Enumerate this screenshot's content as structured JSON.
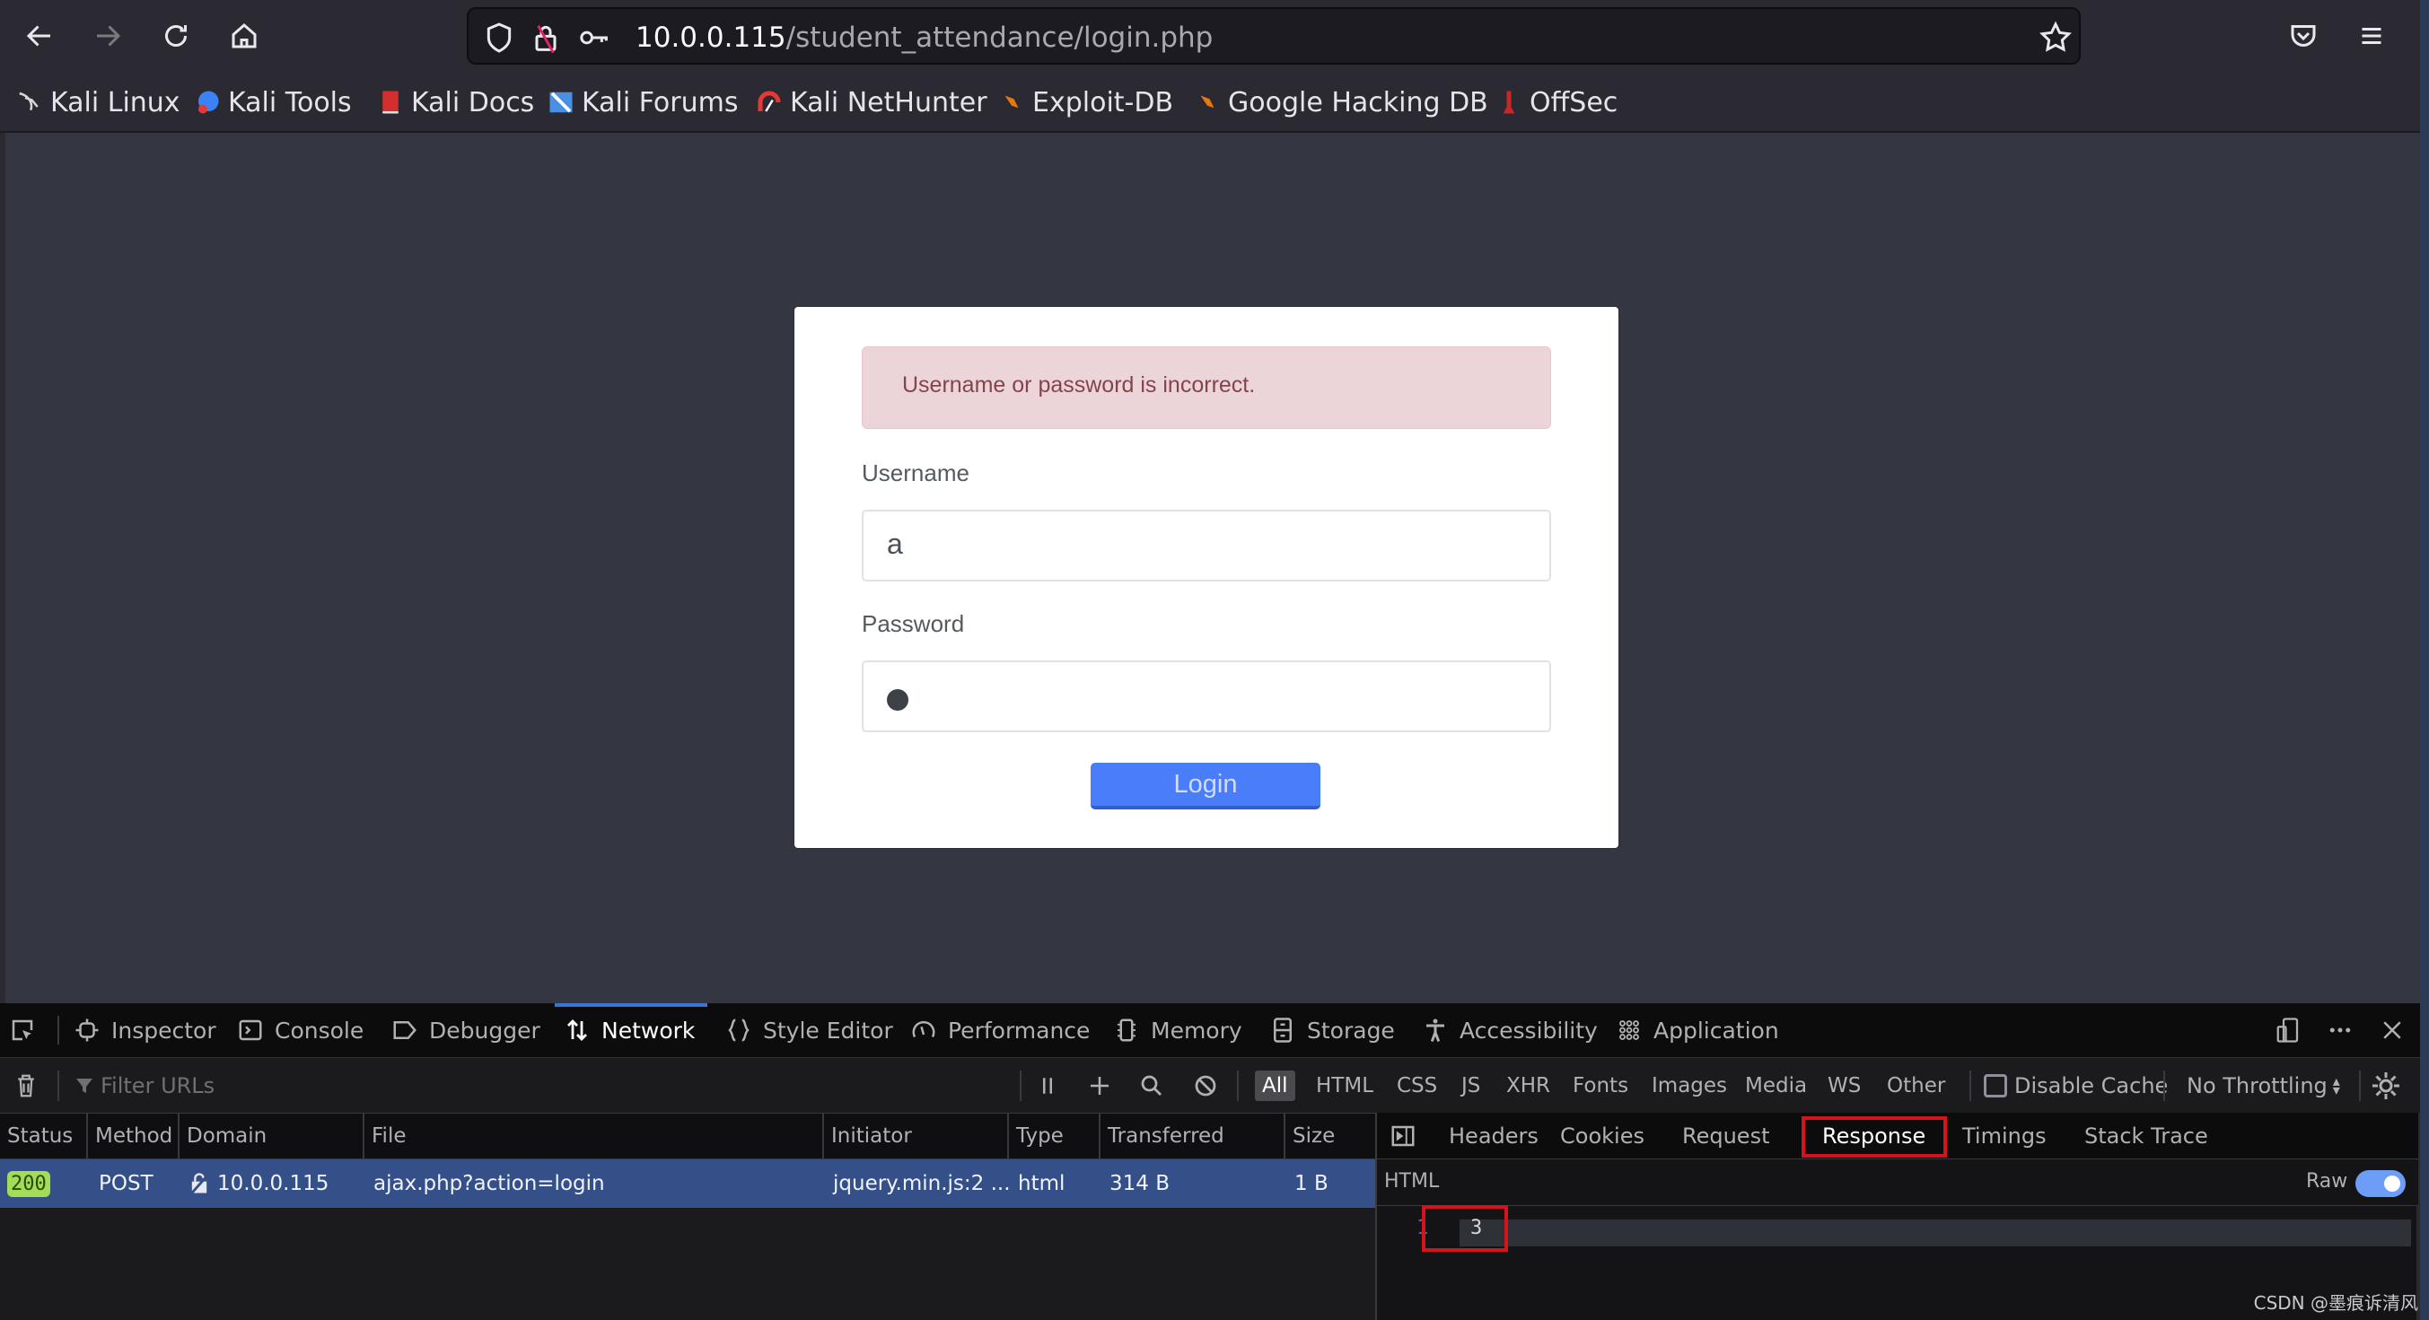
{
  "browser": {
    "url_host": "10.0.0.115",
    "url_path": "/student_attendance/login.php",
    "bookmarks": [
      {
        "label": "Kali Linux",
        "icon": "kali-dragon-icon",
        "color": "#1a1a1a"
      },
      {
        "label": "Kali Tools",
        "icon": "kali-tools-icon",
        "color": "#3b82f6"
      },
      {
        "label": "Kali Docs",
        "icon": "kali-docs-icon",
        "color": "#d32f2f"
      },
      {
        "label": "Kali Forums",
        "icon": "kali-forums-icon",
        "color": "#4a90e2"
      },
      {
        "label": "Kali NetHunter",
        "icon": "kali-nethunter-icon",
        "color": "#d32f2f"
      },
      {
        "label": "Exploit-DB",
        "icon": "exploit-db-icon",
        "color": "#e8770e"
      },
      {
        "label": "Google Hacking DB",
        "icon": "ghdb-icon",
        "color": "#e8770e"
      },
      {
        "label": "OffSec",
        "icon": "offsec-icon",
        "color": "#c62828"
      }
    ]
  },
  "page": {
    "alert_message": "Username or password is incorrect.",
    "username_label": "Username",
    "username_value": "a",
    "password_label": "Password",
    "password_masked_length": 1,
    "login_button": "Login"
  },
  "devtools": {
    "tabs": [
      {
        "label": "Inspector",
        "icon": "inspector-icon"
      },
      {
        "label": "Console",
        "icon": "console-icon"
      },
      {
        "label": "Debugger",
        "icon": "debugger-icon"
      },
      {
        "label": "Network",
        "icon": "network-icon",
        "active": true
      },
      {
        "label": "Style Editor",
        "icon": "style-editor-icon"
      },
      {
        "label": "Performance",
        "icon": "performance-icon"
      },
      {
        "label": "Memory",
        "icon": "memory-icon"
      },
      {
        "label": "Storage",
        "icon": "storage-icon"
      },
      {
        "label": "Accessibility",
        "icon": "accessibility-icon"
      },
      {
        "label": "Application",
        "icon": "application-icon"
      }
    ],
    "filter_placeholder": "Filter URLs",
    "type_filters": [
      "All",
      "HTML",
      "CSS",
      "JS",
      "XHR",
      "Fonts",
      "Images",
      "Media",
      "WS",
      "Other"
    ],
    "active_type_filter": "All",
    "disable_cache_label": "Disable Cache",
    "disable_cache_checked": false,
    "throttling": "No Throttling",
    "columns": [
      "Status",
      "Method",
      "Domain",
      "File",
      "Initiator",
      "Type",
      "Transferred",
      "Size"
    ],
    "requests": [
      {
        "status": "200",
        "method": "POST",
        "domain": "10.0.0.115",
        "file": "ajax.php?action=login",
        "initiator": "jquery.min.js:2 ...",
        "type": "html",
        "transferred": "314 B",
        "size": "1 B"
      }
    ],
    "detail_tabs": [
      "Headers",
      "Cookies",
      "Request",
      "Response",
      "Timings",
      "Stack Trace"
    ],
    "active_detail_tab": "Response",
    "response_type": "HTML",
    "raw_label": "Raw",
    "raw_enabled": true,
    "response_lines": [
      {
        "line": "1",
        "text": "3"
      }
    ]
  },
  "watermark": "CSDN @墨痕诉清风",
  "colors": {
    "accent_blue": "#4a7dfa",
    "selected_row": "#355089",
    "status_ok": "#a3dc57",
    "annotation_red": "#d4131b",
    "alert_bg": "#ecd5d8"
  }
}
